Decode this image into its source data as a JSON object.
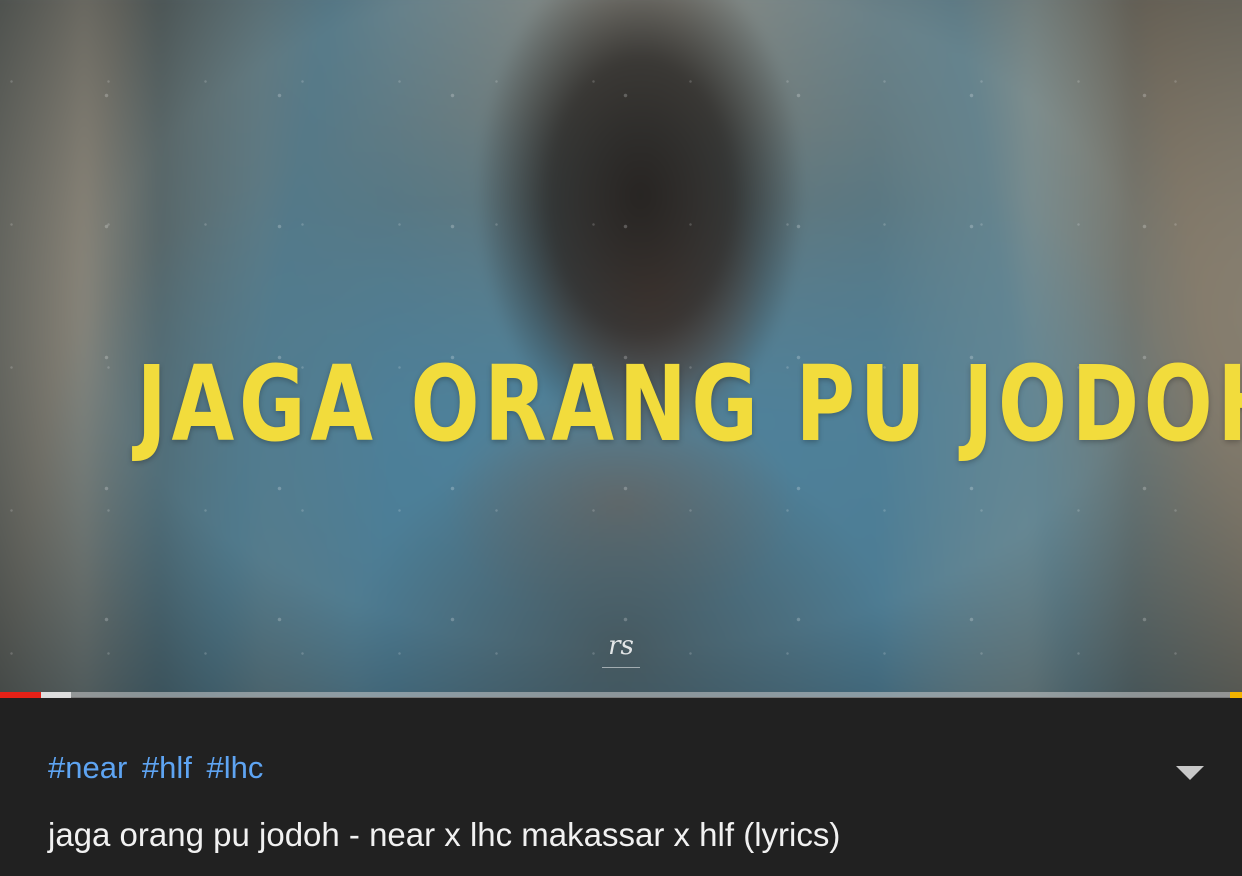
{
  "video": {
    "overlay_title": "JAGA ORANG PU JODOH",
    "watermark": "rs",
    "progress": {
      "played_fraction": 0.033,
      "buffered_fraction": 0.057
    }
  },
  "info": {
    "hashtags": [
      "#near",
      "#hlf",
      "#lhc"
    ],
    "title": "jaga orang pu jodoh - near x lhc makassar x hlf (lyrics)",
    "expand_icon": "chevron-down-icon"
  },
  "colors": {
    "hashtag": "#5ea4f2",
    "progress_played": "#e62117",
    "overlay_text": "#f2dc3c",
    "panel_background": "#212121"
  }
}
